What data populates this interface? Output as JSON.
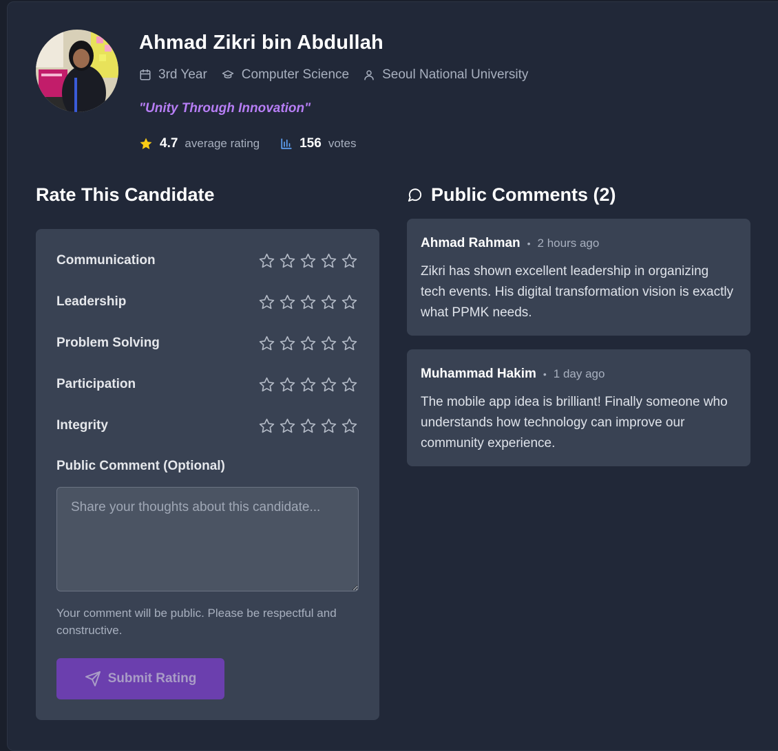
{
  "profile": {
    "name": "Ahmad Zikri bin Abdullah",
    "year": "3rd Year",
    "program": "Computer Science",
    "university": "Seoul National University",
    "slogan": "\"Unity Through Innovation\"",
    "rating": "4.7",
    "rating_label": "average rating",
    "votes": "156",
    "votes_label": "votes"
  },
  "rating_form": {
    "title": "Rate This Candidate",
    "criteria": [
      {
        "label": "Communication",
        "stars": 0
      },
      {
        "label": "Leadership",
        "stars": 0
      },
      {
        "label": "Problem Solving",
        "stars": 0
      },
      {
        "label": "Participation",
        "stars": 0
      },
      {
        "label": "Integrity",
        "stars": 0
      }
    ],
    "max_stars": 5,
    "comment_label": "Public Comment (Optional)",
    "comment_placeholder": "Share your thoughts about this candidate...",
    "comment_value": "",
    "help_text": "Your comment will be public. Please be respectful and constructive.",
    "submit_label": "Submit Rating"
  },
  "comments": {
    "title": "Public Comments (2)",
    "items": [
      {
        "author": "Ahmad Rahman",
        "time": "2 hours ago",
        "text": "Zikri has shown excellent leadership in organizing tech events. His digital transformation vision is exactly what PPMK needs."
      },
      {
        "author": "Muhammad Hakim",
        "time": "1 day ago",
        "text": "The mobile app idea is brilliant! Finally someone who understands how technology can improve our community experience."
      }
    ]
  },
  "colors": {
    "background": "#212838",
    "card": "#394253",
    "accent_purple": "#b77ef5",
    "button": "#6b3fae",
    "star_filled": "#facc15",
    "votes_icon": "#60a5fa"
  }
}
